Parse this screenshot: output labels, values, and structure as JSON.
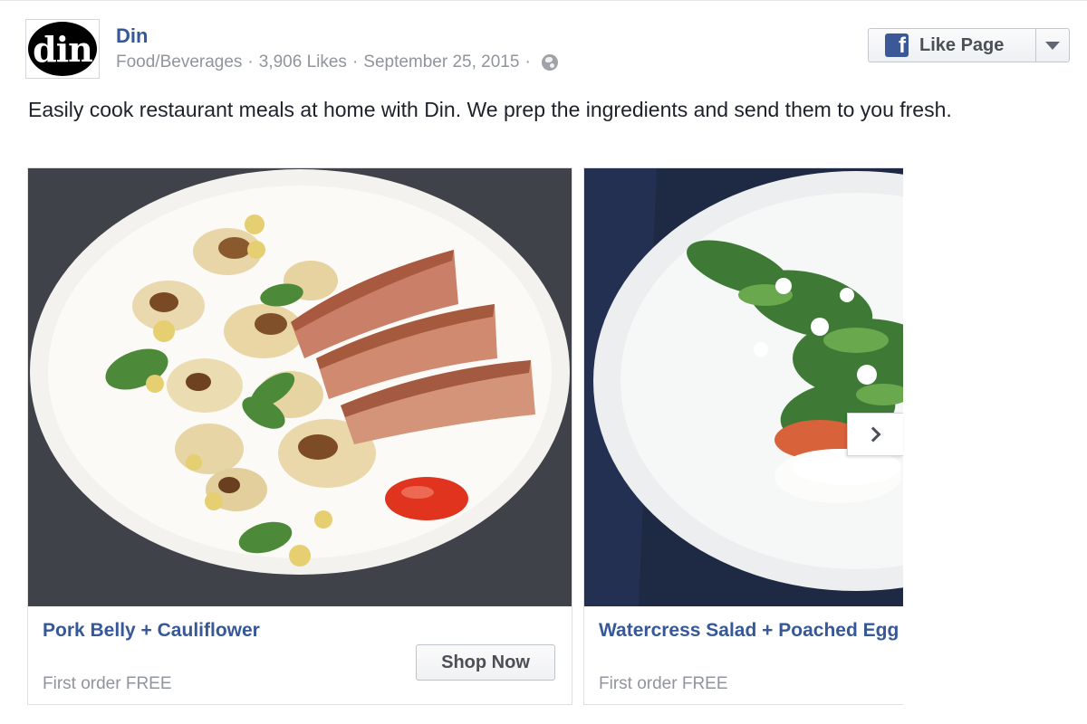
{
  "page": {
    "logo_text": "din",
    "name": "Din",
    "category": "Food/Beverages",
    "likes": "3,906 Likes",
    "date": "September 25, 2015",
    "sep": "·",
    "privacy_icon": "globe-icon"
  },
  "like_button": {
    "label": "Like Page",
    "icon": "facebook-icon",
    "icon_glyph": "f"
  },
  "post": {
    "text": "Easily cook restaurant meals at home with Din. We prep the ingredients and send them to you fresh."
  },
  "carousel": {
    "cards": [
      {
        "title": "Pork Belly + Cauliflower",
        "subtitle": "First order FREE",
        "cta": "Shop Now"
      },
      {
        "title": "Watercress Salad + Poached Egg",
        "subtitle": "First order FREE"
      }
    ],
    "next_icon": "chevron-right-icon"
  },
  "colors": {
    "link_blue": "#365899",
    "meta_gray": "#90949c",
    "facebook_blue": "#3b5998"
  }
}
